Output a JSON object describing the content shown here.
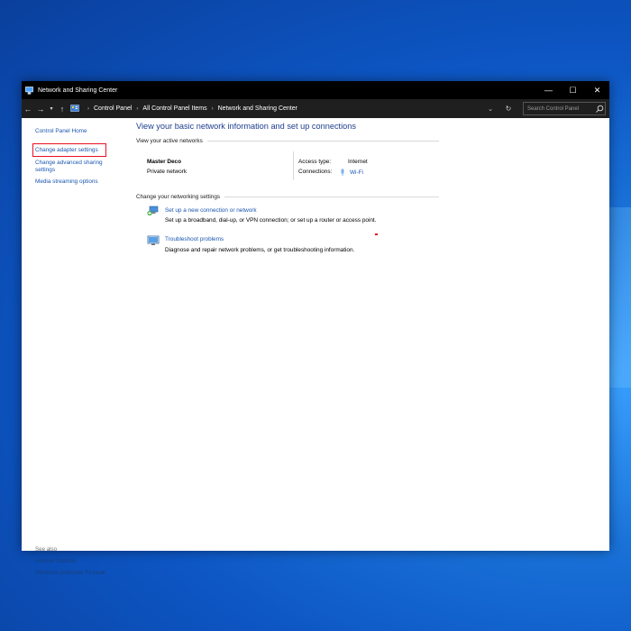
{
  "window": {
    "title": "Network and Sharing Center",
    "controls": {
      "minimize": "—",
      "maximize": "☐",
      "close": "✕"
    }
  },
  "address_bar": {
    "back": "←",
    "forward": "→",
    "recent": "▾",
    "up": "↑",
    "breadcrumb": [
      "Control Panel",
      "All Control Panel Items",
      "Network and Sharing Center"
    ],
    "separator": "›",
    "dropdown": "⌄",
    "refresh": "↻",
    "search_placeholder": "Search Control Panel"
  },
  "sidebar": {
    "home": "Control Panel Home",
    "links": [
      "Change adapter settings",
      "Change advanced sharing settings",
      "Media streaming options"
    ],
    "see_also_label": "See also",
    "see_also": [
      "Internet Options",
      "Windows Defender Firewall"
    ]
  },
  "main": {
    "title": "View your basic network information and set up connections",
    "active_networks_heading": "View your active networks",
    "network": {
      "name": "Master Deco",
      "type": "Private network",
      "access_type_label": "Access type:",
      "access_type_value": "Internet",
      "connections_label": "Connections:",
      "connections_value": "Wi-Fi"
    },
    "change_settings_heading": "Change your networking settings",
    "tasks": [
      {
        "link": "Set up a new connection or network",
        "description": "Set up a broadband, dial-up, or VPN connection; or set up a router or access point."
      },
      {
        "link": "Troubleshoot problems",
        "description": "Diagnose and repair network problems, or get troubleshooting information."
      }
    ]
  },
  "colors": {
    "link": "#1a56b0",
    "title_blue": "#1e3d8f",
    "highlight": "#e81123",
    "titlebar": "#000000"
  }
}
